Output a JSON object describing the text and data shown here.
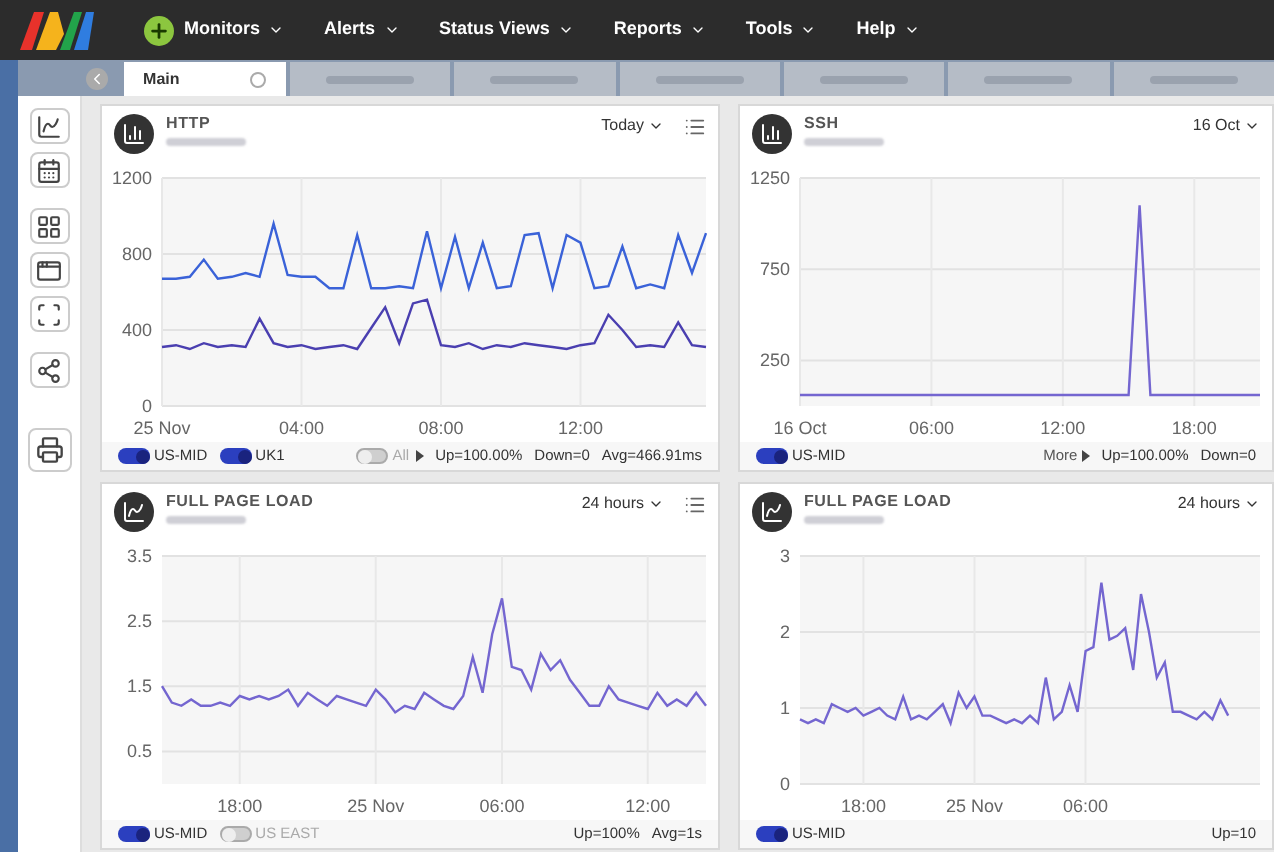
{
  "nav": {
    "items": [
      {
        "label": "Monitors",
        "add": true
      },
      {
        "label": "Alerts",
        "add": false
      },
      {
        "label": "Status Views",
        "add": false
      },
      {
        "label": "Reports",
        "add": false
      },
      {
        "label": "Tools",
        "add": false
      },
      {
        "label": "Help",
        "add": false
      }
    ]
  },
  "tabs": [
    {
      "label": "Main",
      "selected": true
    },
    {
      "selected": false
    },
    {
      "selected": false
    },
    {
      "selected": false
    },
    {
      "selected": false
    },
    {
      "selected": false
    },
    {
      "selected": false
    }
  ],
  "panels": [
    {
      "title": "HTTP",
      "range": "Today",
      "menu": true,
      "chart_data": {
        "type": "line",
        "grid": true,
        "ylim": [
          0,
          1200
        ],
        "yticks": [
          0,
          400,
          800,
          1200
        ],
        "xticks": [
          {
            "value": 0,
            "label": "25 Nov"
          },
          {
            "value": 4,
            "label": "04:00"
          },
          {
            "value": 8,
            "label": "08:00"
          },
          {
            "value": 12,
            "label": "12:00"
          }
        ],
        "xlim": [
          0,
          15.6
        ],
        "x": [
          0,
          0.4,
          0.8,
          1.2,
          1.6,
          2,
          2.4,
          2.8,
          3.2,
          3.6,
          4,
          4.4,
          4.8,
          5.2,
          5.6,
          6,
          6.4,
          6.8,
          7.2,
          7.6,
          8,
          8.4,
          8.8,
          9.2,
          9.6,
          10,
          10.4,
          10.8,
          11.2,
          11.6,
          12,
          12.4,
          12.8,
          13.2,
          13.6,
          14,
          14.4,
          14.8,
          15.2,
          15.6
        ],
        "series": [
          {
            "color": "#3a62d8",
            "values": [
              670,
              670,
              680,
              770,
              670,
              680,
              700,
              680,
              960,
              690,
              680,
              680,
              620,
              620,
              900,
              620,
              620,
              630,
              620,
              920,
              620,
              890,
              620,
              860,
              620,
              630,
              900,
              910,
              620,
              900,
              860,
              620,
              630,
              840,
              620,
              640,
              620,
              900,
              700,
              910
            ]
          },
          {
            "color": "#4a3fb0",
            "values": [
              310,
              320,
              300,
              330,
              310,
              320,
              310,
              460,
              330,
              310,
              320,
              300,
              310,
              320,
              300,
              410,
              520,
              330,
              540,
              560,
              320,
              310,
              330,
              300,
              320,
              310,
              330,
              320,
              310,
              300,
              320,
              330,
              480,
              400,
              310,
              320,
              310,
              440,
              320,
              310
            ]
          }
        ]
      },
      "left": [
        {
          "kind": "toggle",
          "label": "US-MID",
          "on": true
        },
        {
          "kind": "toggle",
          "label": "UK1",
          "on": true
        }
      ],
      "right": [
        {
          "kind": "toggle",
          "label": "All",
          "on": false,
          "caret": true
        },
        {
          "kind": "stat",
          "label": "Up=100.00%"
        },
        {
          "kind": "stat",
          "label": "Down=0"
        },
        {
          "kind": "stat",
          "label": "Avg=466.91ms"
        }
      ]
    },
    {
      "title": "SSH",
      "range": "16 Oct",
      "menu": false,
      "chart_data": {
        "type": "line",
        "grid": true,
        "ylim": [
          0,
          1250
        ],
        "yticks": [
          250,
          750,
          1250
        ],
        "xticks": [
          {
            "value": 0,
            "label": "16 Oct"
          },
          {
            "value": 6,
            "label": "06:00"
          },
          {
            "value": 12,
            "label": "12:00"
          },
          {
            "value": 18,
            "label": "18:00"
          }
        ],
        "xlim": [
          0,
          21
        ],
        "x": [
          0,
          0.5,
          1,
          1.5,
          2,
          2.5,
          3,
          3.5,
          4,
          4.5,
          5,
          5.5,
          6,
          6.5,
          7,
          7.5,
          8,
          8.5,
          9,
          9.5,
          10,
          10.5,
          11,
          11.5,
          12,
          12.5,
          13,
          13.5,
          14,
          14.5,
          15,
          15.5,
          16,
          16.5,
          17,
          17.5,
          18,
          18.5,
          19,
          19.5,
          20,
          20.5,
          21
        ],
        "series": [
          {
            "color": "#7466d0",
            "values": [
              60,
              60,
              60,
              60,
              60,
              60,
              60,
              60,
              60,
              60,
              60,
              60,
              60,
              60,
              60,
              60,
              60,
              60,
              60,
              60,
              60,
              60,
              60,
              60,
              60,
              60,
              60,
              60,
              60,
              60,
              60,
              1100,
              60,
              60,
              60,
              60,
              60,
              60,
              60,
              60,
              60,
              60,
              60
            ]
          }
        ]
      },
      "left": [
        {
          "kind": "toggle",
          "label": "US-MID",
          "on": true
        }
      ],
      "right": [
        {
          "kind": "more",
          "label": "More"
        },
        {
          "kind": "stat",
          "label": "Up=100.00%"
        },
        {
          "kind": "stat",
          "label": "Down=0"
        }
      ]
    },
    {
      "title": "FULL PAGE LOAD",
      "range": "24 hours",
      "menu": true,
      "chart_data": {
        "type": "line",
        "grid": true,
        "ylim": [
          0,
          3.5
        ],
        "yticks": [
          0.5,
          1.5,
          2.5,
          3.5
        ],
        "categories": [
          null,
          null,
          null,
          null,
          null,
          null,
          null,
          null,
          "18:00",
          null,
          null,
          null,
          null,
          null,
          null,
          null,
          null,
          null,
          null,
          null,
          null,
          null,
          "25 Nov",
          null,
          null,
          null,
          null,
          null,
          null,
          null,
          null,
          null,
          null,
          null,
          null,
          "06:00",
          null,
          null,
          null,
          null,
          null,
          null,
          null,
          null,
          null,
          null,
          null,
          null,
          null,
          null,
          "12:00",
          null,
          null,
          null,
          null,
          null,
          null
        ],
        "series": [
          {
            "color": "#7466d0",
            "values": [
              1.5,
              1.25,
              1.2,
              1.3,
              1.2,
              1.2,
              1.25,
              1.2,
              1.35,
              1.3,
              1.35,
              1.3,
              1.35,
              1.45,
              1.2,
              1.4,
              1.3,
              1.2,
              1.35,
              1.3,
              1.25,
              1.2,
              1.45,
              1.3,
              1.1,
              1.2,
              1.15,
              1.4,
              1.3,
              1.2,
              1.15,
              1.35,
              1.95,
              1.4,
              2.3,
              2.85,
              1.8,
              1.75,
              1.45,
              2.0,
              1.75,
              1.9,
              1.6,
              1.4,
              1.2,
              1.2,
              1.5,
              1.3,
              1.25,
              1.2,
              1.15,
              1.4,
              1.2,
              1.3,
              1.2,
              1.4,
              1.2
            ]
          }
        ]
      },
      "left": [
        {
          "kind": "toggle",
          "label": "US-MID",
          "on": true
        },
        {
          "kind": "toggle",
          "label": "US EAST",
          "on": false
        }
      ],
      "right": [
        {
          "kind": "stat",
          "label": "Up=100%"
        },
        {
          "kind": "stat",
          "label": "Avg=1s"
        }
      ]
    },
    {
      "title": "FULL PAGE LOAD",
      "range": "24 hours",
      "menu": false,
      "chart_data": {
        "type": "line",
        "grid": true,
        "ylim": [
          0,
          3
        ],
        "yticks": [
          0,
          1,
          2,
          3
        ],
        "categories": [
          null,
          null,
          null,
          null,
          null,
          null,
          null,
          null,
          "18:00",
          null,
          null,
          null,
          null,
          null,
          null,
          null,
          null,
          null,
          null,
          null,
          null,
          null,
          "25 Nov",
          null,
          null,
          null,
          null,
          null,
          null,
          null,
          null,
          null,
          null,
          null,
          null,
          null,
          "06:00",
          null,
          null,
          null,
          null,
          null,
          null,
          null,
          null,
          null,
          null,
          null,
          null,
          null,
          null,
          null,
          null,
          null,
          null,
          null,
          null,
          null,
          null
        ],
        "series": [
          {
            "color": "#7466d0",
            "values": [
              0.85,
              0.8,
              0.85,
              0.8,
              1.05,
              1.0,
              0.95,
              1.0,
              0.9,
              0.95,
              1.0,
              0.9,
              0.85,
              1.15,
              0.85,
              0.9,
              0.85,
              0.95,
              1.05,
              0.8,
              1.2,
              1.0,
              1.15,
              0.9,
              0.9,
              0.85,
              0.8,
              0.85,
              0.8,
              0.9,
              0.8,
              1.4,
              0.85,
              0.95,
              1.3,
              0.95,
              1.75,
              1.8,
              2.65,
              1.9,
              1.95,
              2.05,
              1.5,
              2.5,
              2.0,
              1.4,
              1.6,
              0.95,
              0.95,
              0.9,
              0.85,
              0.95,
              0.85,
              1.1,
              0.9,
              null,
              null,
              null,
              null
            ]
          }
        ]
      },
      "left": [
        {
          "kind": "toggle",
          "label": "US-MID",
          "on": true
        }
      ],
      "right": [
        {
          "kind": "stat",
          "label": "Up=10"
        }
      ]
    }
  ]
}
